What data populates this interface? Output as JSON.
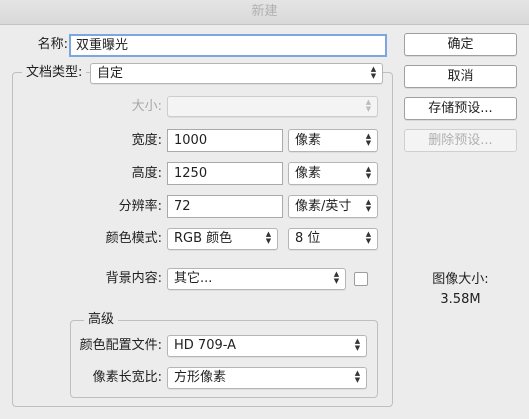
{
  "window": {
    "title": "新建"
  },
  "name": {
    "label": "名称:",
    "value": "双重曝光"
  },
  "doc_type": {
    "label": "文档类型:",
    "value": "自定"
  },
  "size": {
    "label": "大小:",
    "value": ""
  },
  "width": {
    "label": "宽度:",
    "value": "1000",
    "unit": "像素"
  },
  "height": {
    "label": "高度:",
    "value": "1250",
    "unit": "像素"
  },
  "resolution": {
    "label": "分辨率:",
    "value": "72",
    "unit": "像素/英寸"
  },
  "color_mode": {
    "label": "颜色模式:",
    "value": "RGB 颜色",
    "bit_depth": "8 位"
  },
  "background": {
    "label": "背景内容:",
    "value": "其它..."
  },
  "advanced": {
    "title": "高级",
    "color_profile": {
      "label": "颜色配置文件:",
      "value": "HD 709-A"
    },
    "pixel_aspect": {
      "label": "像素长宽比:",
      "value": "方形像素"
    }
  },
  "buttons": {
    "ok": "确定",
    "cancel": "取消",
    "save_preset": "存储预设...",
    "delete_preset": "删除预设..."
  },
  "image_size": {
    "label": "图像大小:",
    "value": "3.58M"
  },
  "colors": {
    "focus_border": "#7aa7e0",
    "window_bg": "#ececec"
  }
}
